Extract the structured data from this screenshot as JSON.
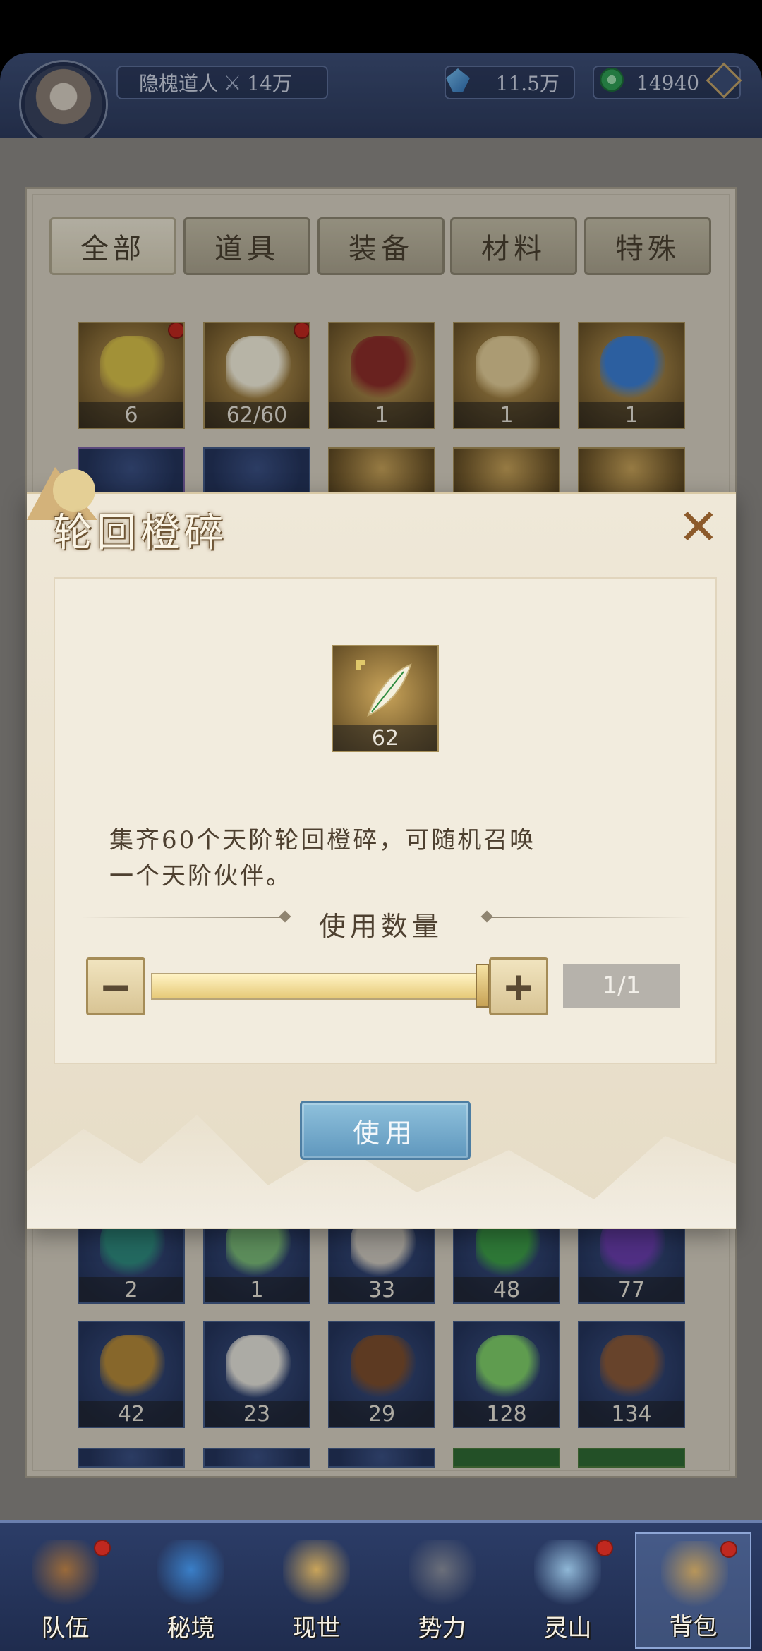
{
  "header": {
    "player_name": "隐槐道人",
    "power": "14万",
    "crystal": "11.5万",
    "jade": "14940"
  },
  "tabs": [
    "全部",
    "道具",
    "装备",
    "材料",
    "特殊"
  ],
  "inventory_top": [
    {
      "count": "6",
      "color": "#d9c24a",
      "badge": true
    },
    {
      "count": "62/60",
      "color": "#f4f0de",
      "badge": true
    },
    {
      "count": "1",
      "color": "#8c2e2a",
      "badge": false
    },
    {
      "count": "1",
      "color": "#e4cf9a",
      "badge": false
    },
    {
      "count": "1",
      "color": "#3b7fd6",
      "badge": false
    }
  ],
  "inventory_bottom_row1": [
    {
      "count": "2",
      "color": "#2f8c80"
    },
    {
      "count": "1",
      "color": "#7bbd7a"
    },
    {
      "count": "33",
      "color": "#cfcac0"
    },
    {
      "count": "48",
      "color": "#3ea04a"
    },
    {
      "count": "77",
      "color": "#6b3fb0"
    }
  ],
  "inventory_bottom_row2": [
    {
      "count": "42",
      "color": "#b58a3a"
    },
    {
      "count": "23",
      "color": "#e6e4dc"
    },
    {
      "count": "29",
      "color": "#7c4e2e"
    },
    {
      "count": "128",
      "color": "#7fd06a"
    },
    {
      "count": "134",
      "color": "#8a5a3a"
    }
  ],
  "dialog": {
    "title": "轮回橙碎",
    "close": "✕",
    "item_count": "62",
    "description_line1": "集齐60个天阶轮回橙碎，可随机召唤",
    "description_line2": "一个天阶伙伴。",
    "quantity_label": "使用数量",
    "minus": "−",
    "plus": "+",
    "quantity": "1/1",
    "slider_fraction": 1.0,
    "use_button": "使用"
  },
  "nav": [
    {
      "label": "队伍",
      "badge": true,
      "icon": "team-icon",
      "color": "#9a6a3a"
    },
    {
      "label": "秘境",
      "badge": false,
      "icon": "realm-icon",
      "color": "#3a7fc8"
    },
    {
      "label": "现世",
      "badge": false,
      "icon": "world-icon",
      "color": "#c9a45a"
    },
    {
      "label": "势力",
      "badge": false,
      "icon": "faction-icon",
      "color": "#6b6f7a"
    },
    {
      "label": "灵山",
      "badge": true,
      "icon": "mountain-icon",
      "color": "#8fb7d6"
    },
    {
      "label": "背包",
      "badge": true,
      "icon": "bag-icon",
      "color": "#b8965a"
    }
  ],
  "colors": {
    "accent_red": "#c0281f",
    "use_button_blue": "#5f97bd"
  }
}
